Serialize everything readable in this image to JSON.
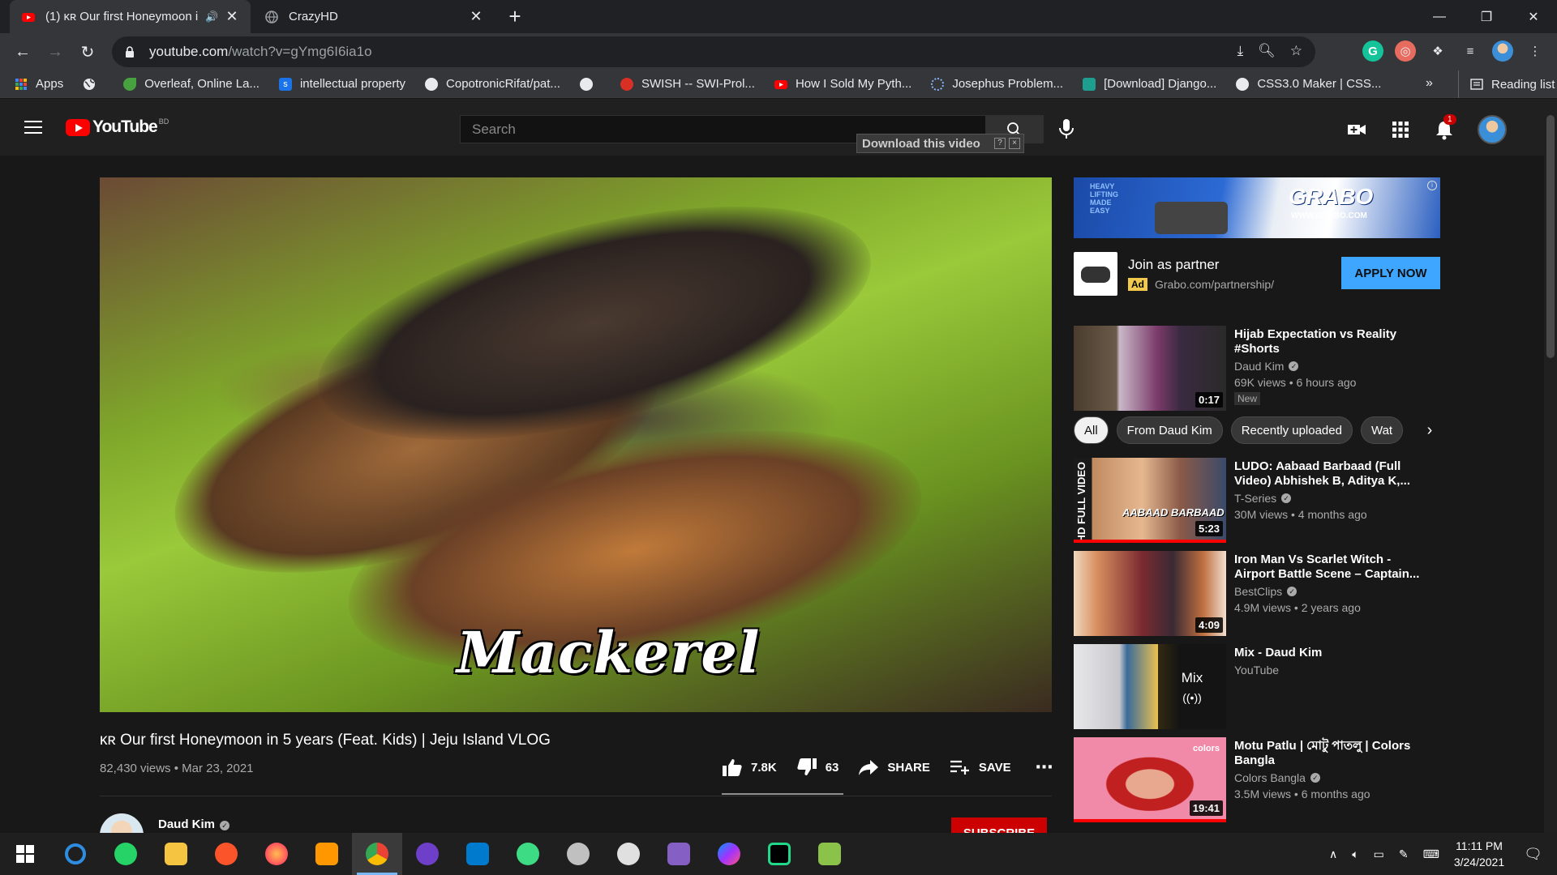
{
  "browser": {
    "tabs": [
      {
        "title": "(1) ᴋʀ Our first Honeymoon i",
        "active": true
      },
      {
        "title": "CrazyHD",
        "active": false
      }
    ],
    "new_tab": "+",
    "url_host": "youtube.com",
    "url_path": "/watch?v=gYmg6I6ia1o",
    "bookmarks": [
      {
        "label": "Apps",
        "icon": "apps-grid-icon",
        "color": "#4285f4"
      },
      {
        "label": "",
        "icon": "globe-icon",
        "color": "#9aa0a6"
      },
      {
        "label": "Overleaf, Online La...",
        "icon": "overleaf-icon",
        "color": "#47a141"
      },
      {
        "label": "intellectual property",
        "icon": "s-icon",
        "color": "#1a73e8"
      },
      {
        "label": "CopotronicRifat/pat...",
        "icon": "github-icon",
        "color": "#e8eaed"
      },
      {
        "label": "",
        "icon": "globe-icon",
        "color": "#9aa0a6"
      },
      {
        "label": "SWISH -- SWI-Prol...",
        "icon": "swish-icon",
        "color": "#d93025"
      },
      {
        "label": "How I Sold My Pyth...",
        "icon": "youtube-icon",
        "color": "#ff0000"
      },
      {
        "label": "Josephus Problem...",
        "icon": "loading-icon",
        "color": "#8ab4f8"
      },
      {
        "label": "[Download] Django...",
        "icon": "django-icon",
        "color": "#1e9e8f"
      },
      {
        "label": "CSS3.0 Maker | CSS...",
        "icon": "globe-icon",
        "color": "#9aa0a6"
      }
    ],
    "bookmarks_more": "»",
    "reading_list": "Reading list"
  },
  "youtube": {
    "logo_text": "YouTube",
    "country_code": "BD",
    "search_placeholder": "Search",
    "download_bar": "Download this video",
    "download_help": "?",
    "download_close": "×",
    "notifications": "1",
    "video": {
      "overlay_text": "Mackerel",
      "title": "ᴋʀ Our first Honeymoon in 5 years (Feat. Kids) | Jeju Island VLOG",
      "meta": "82,430 views • Mar 23, 2021",
      "likes": "7.8K",
      "dislikes": "63",
      "share": "SHARE",
      "save": "SAVE",
      "channel": "Daud Kim",
      "subscribe": "SUBSCRIBE"
    },
    "ad": {
      "brand": "GRABO",
      "brand_url": "WWW.GRABO.COM",
      "tagline": "HEAVY LIFTING MADE EASY",
      "title": "Join as partner",
      "badge": "Ad",
      "url": "Grabo.com/partnership/",
      "cta": "APPLY NOW"
    },
    "chips": [
      "All",
      "From Daud Kim",
      "Recently uploaded",
      "Wat"
    ],
    "recommendations": [
      {
        "title": "Hijab Expectation vs Reality #Shorts",
        "channel": "Daud Kim",
        "views": "69K views • 6 hours ago",
        "duration": "0:17",
        "badge": "New",
        "verified": true
      },
      {
        "title": "LUDO: Aabaad Barbaad (Full Video) Abhishek B, Aditya K,...",
        "channel": "T-Series",
        "views": "30M views • 4 months ago",
        "duration": "5:23",
        "verified": true,
        "thumb_text": "HD FULL VIDEO",
        "thumb_title": "AABAAD BARBAAD"
      },
      {
        "title": "Iron Man Vs Scarlet Witch - Airport Battle Scene – Captain...",
        "channel": "BestClips",
        "views": "4.9M views • 2 years ago",
        "duration": "4:09",
        "verified": true
      },
      {
        "title": "Mix - Daud Kim",
        "channel": "YouTube",
        "mix_label": "Mix",
        "mix_icon": "((•))"
      },
      {
        "title": "Motu Patlu | মোটু পাতলু | Colors Bangla",
        "channel": "Colors Bangla",
        "views": "3.5M views • 6 months ago",
        "duration": "19:41",
        "verified": true,
        "thumb_text": "colors"
      }
    ]
  },
  "taskbar": {
    "apps": [
      "windows-start-icon",
      "update-icon",
      "whatsapp-icon",
      "file-explorer-icon",
      "brave-icon",
      "firefox-icon",
      "sublime-icon",
      "chrome-icon",
      "github-desktop-icon",
      "vscode-icon",
      "android-studio-icon",
      "storm-icon",
      "inkscape-icon",
      "visual-studio-icon",
      "messenger-icon",
      "pycharm-icon",
      "notepad-icon"
    ],
    "active_app": "chrome-icon",
    "time": "11:11 PM",
    "date": "3/24/2021"
  },
  "colors": {
    "yt_red": "#ff0000",
    "accent_blue": "#3ea6ff",
    "ad_yellow": "#f2c94c"
  }
}
